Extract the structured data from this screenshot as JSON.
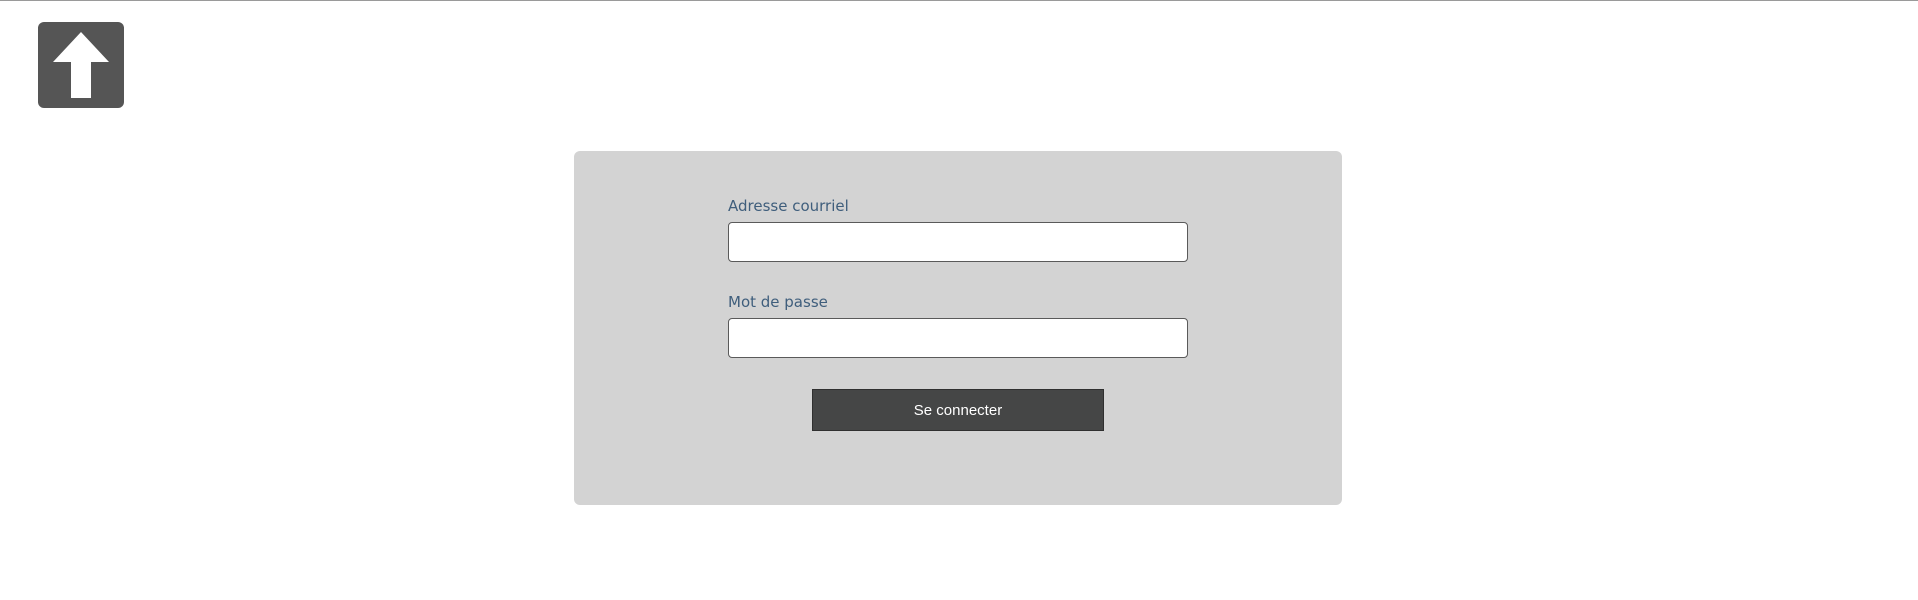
{
  "logo": {
    "icon": "arrow-up-icon",
    "color": "#555555"
  },
  "login_form": {
    "email": {
      "label": "Adresse courriel",
      "value": "",
      "placeholder": ""
    },
    "password": {
      "label": "Mot de passe",
      "value": "",
      "placeholder": ""
    },
    "submit_label": "Se connecter"
  },
  "colors": {
    "panel_background": "#d3d3d3",
    "button_background": "#454646",
    "label_text": "#3f5e7c"
  }
}
